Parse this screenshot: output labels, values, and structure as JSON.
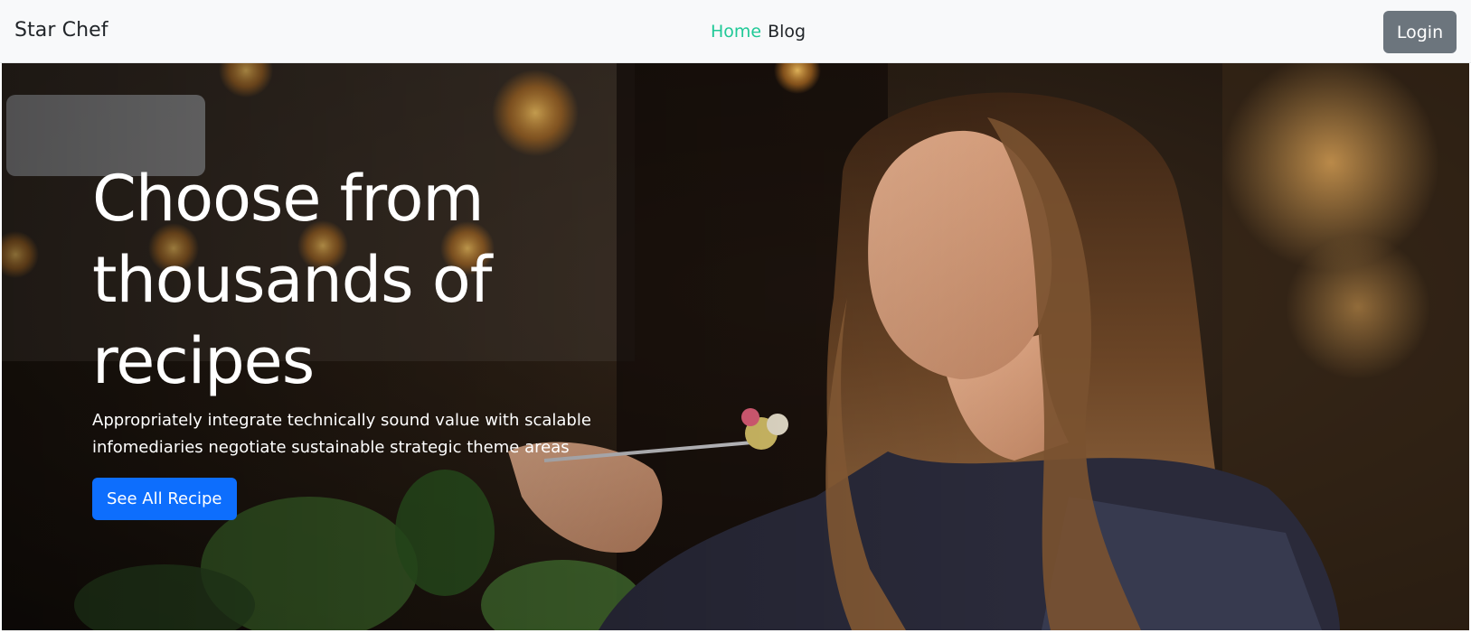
{
  "colors": {
    "accent": "#20c997",
    "primary": "#0d6efd",
    "secondary": "#6c757d",
    "navbar_bg": "#f8f9fa"
  },
  "navbar": {
    "brand": "Star Chef",
    "links": [
      {
        "label": "Home",
        "active": true
      },
      {
        "label": "Blog",
        "active": false
      }
    ],
    "login_label": "Login"
  },
  "hero": {
    "image": "woman-eating-pasta-photo",
    "title": "Choose from thousands of recipes",
    "text": "Appropriately integrate technically sound value with scalable infomediaries negotiate sustainable strategic theme areas",
    "button_label": "See All Recipe"
  }
}
